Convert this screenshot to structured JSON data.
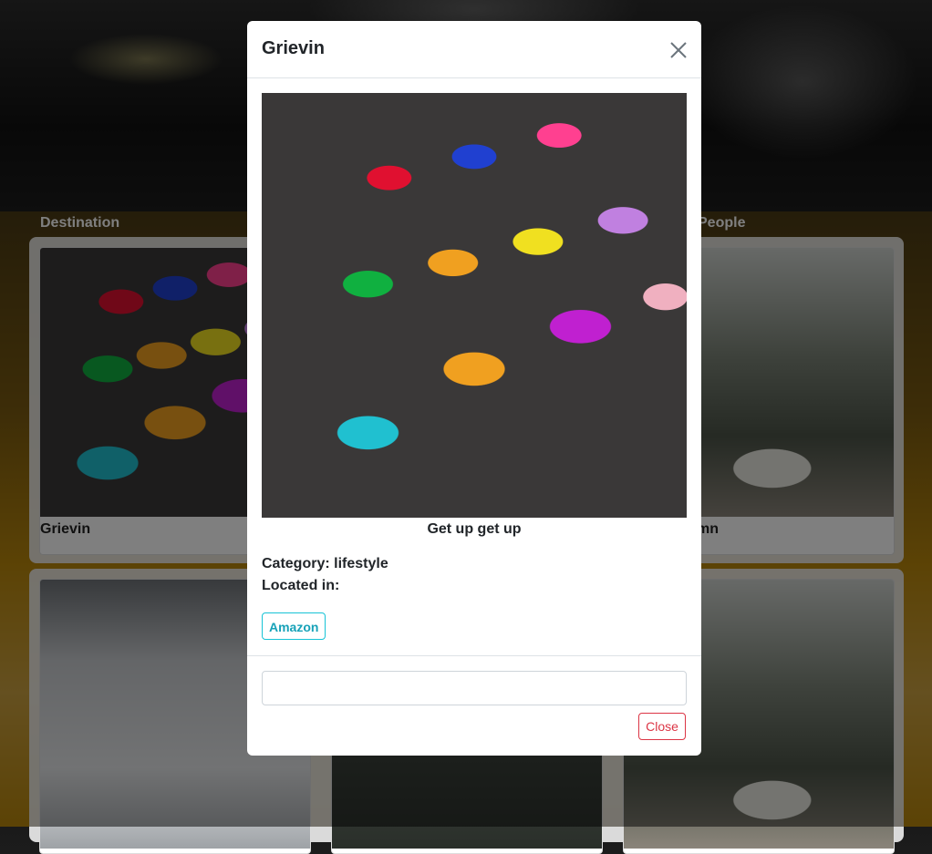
{
  "background": {
    "sections": {
      "destination": "Destination",
      "people": "People"
    },
    "cards": [
      {
        "title": "Grievin",
        "image": "colorful-felt-letters"
      },
      {
        "title": "",
        "image": "dark-scene"
      },
      {
        "title": "mn",
        "image": "palm-trees-with-vehicle"
      },
      {
        "title": "",
        "image": "wrapped-arch-monument"
      },
      {
        "title": "",
        "image": "dark-forest"
      },
      {
        "title": "",
        "image": "palm-trees"
      }
    ]
  },
  "modal": {
    "title": "Grievin",
    "close_icon": "close-icon",
    "image": "colorful-felt-letters",
    "caption": "Get up get up",
    "category_label": "Category:",
    "category_value": "lifestyle",
    "location_label": "Located in:",
    "location_value": "",
    "link_button": "Amazon",
    "footer_input_value": "",
    "footer_input_placeholder": "",
    "close_button": "Close"
  },
  "colors": {
    "info": "#17a2b8",
    "danger": "#dc3545",
    "backdrop": "rgba(0,0,0,0.5)"
  }
}
